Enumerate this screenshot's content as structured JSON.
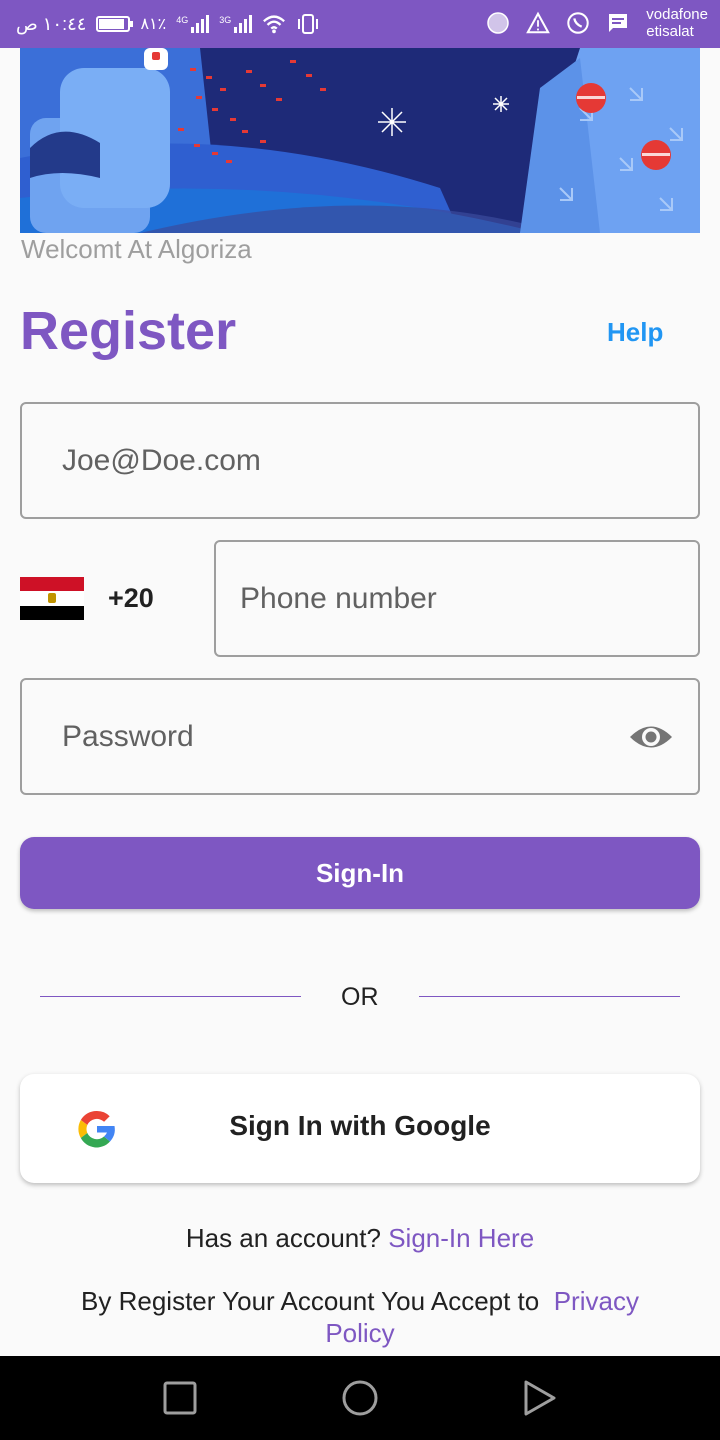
{
  "status_bar": {
    "time": "١٠:٤٤ ص",
    "battery": "٨١٪",
    "battery_level": 0.81,
    "network_1": "4G",
    "network_2": "3G",
    "carrier_line1": "vodafone",
    "carrier_line2": "etisalat"
  },
  "welcome_text": "Welcomt At Algoriza",
  "header": {
    "title": "Register",
    "help": "Help"
  },
  "form": {
    "email_placeholder": "Joe@Doe.com",
    "country_code": "+20",
    "phone_placeholder": "Phone number",
    "password_placeholder": "Password"
  },
  "signin_button": "Sign-In",
  "divider_text": "OR",
  "google_button": "Sign In with Google",
  "footer": {
    "has_account": "Has an account?",
    "signin_link": "Sign-In Here",
    "terms_prefix": "By Register Your Account You Accept to",
    "privacy_link": "Privacy Policy"
  },
  "colors": {
    "primary": "#7e57c2",
    "help": "#2196f3"
  }
}
